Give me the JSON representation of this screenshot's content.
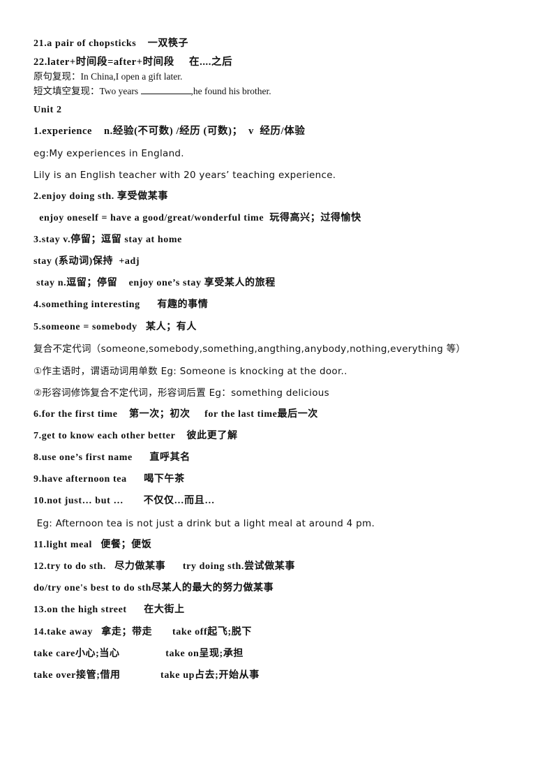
{
  "lines": {
    "l21": "21.a pair of chopsticks    一双筷子",
    "l22": "22.later+时间段=after+时间段     在....之后",
    "orig_label": "原句复现：",
    "orig_text": "In China,I open a gift later.",
    "fill_label": "短文填空复现：",
    "fill_before": "Two years ",
    "fill_after": ",he found his brother.",
    "unit": "Unit 2",
    "p1": "1.experience    n.经验(不可数) /经历 (可数)；  v  经历/体验",
    "p1_eg": "eg:My experiences in England.",
    "p1_eg2": "Lily is an English teacher with 20 years’ teaching experience.",
    "p2": "2.enjoy doing sth. 享受做某事",
    "p2b": "  enjoy oneself = have a good/great/wonderful time  玩得高兴；过得愉快",
    "p3": "3.stay v.停留；逗留 stay at home",
    "p3b": "stay (系动词)保持  +adj",
    "p3c": " stay n.逗留；停留    enjoy one’s stay 享受某人的旅程",
    "p4": "4.something interesting      有趣的事情",
    "p5": "5.someone = somebody   某人；有人",
    "p5a": "复合不定代词（someone,somebody,something,angthing,anybody,nothing,everything 等）",
    "p5b": "①作主语时，谓语动词用单数 Eg: Someone is knocking at the door..",
    "p5c": "②形容词修饰复合不定代词，形容词后置 Eg：something delicious",
    "p6": "6.for the first time    第一次；初次     for the last time最后一次",
    "p7": "7.get to know each other better    彼此更了解",
    "p8": "8.use one’s first name      直呼其名",
    "p9": "9.have afternoon tea      喝下午茶",
    "p10": "10.not just… but …       不仅仅…而且…",
    "p10_eg": " Eg: Afternoon tea is not just a drink but a light meal at around 4 pm.",
    "p11": "11.light meal   便餐；便饭",
    "p12": "12.try to do sth.   尽力做某事      try doing sth.尝试做某事",
    "p12b": "do/try one's best to do sth尽某人的最大的努力做某事",
    "p13": "13.on the high street      在大街上",
    "p14": "14.take away   拿走；带走       take off起飞;脱下",
    "p14b": "take care小心;当心                take on呈现;承担",
    "p14c": "take over接管;借用              take up占去;开始从事"
  }
}
